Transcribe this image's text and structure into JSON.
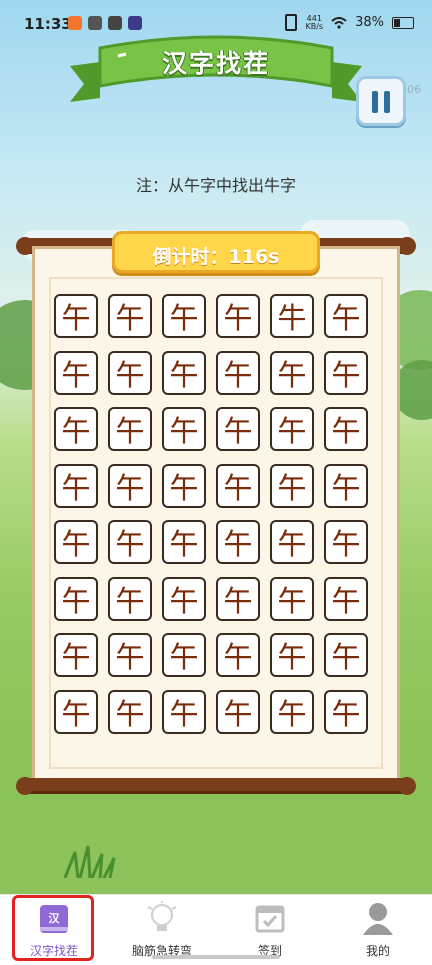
{
  "status_bar": {
    "time": "11:33",
    "net_speed_value": "441",
    "net_speed_unit": "KB/s",
    "battery": "38%"
  },
  "title": "汉字找茬",
  "watermark": "0x603e06",
  "note": "注：从午字中找出牛字",
  "timer": "倒计时：116s",
  "grid": {
    "rows": [
      [
        "午",
        "午",
        "午",
        "午",
        "牛",
        "午"
      ],
      [
        "午",
        "午",
        "午",
        "午",
        "午",
        "午"
      ],
      [
        "午",
        "午",
        "午",
        "午",
        "午",
        "午"
      ],
      [
        "午",
        "午",
        "午",
        "午",
        "午",
        "午"
      ],
      [
        "午",
        "午",
        "午",
        "午",
        "午",
        "午"
      ],
      [
        "午",
        "午",
        "午",
        "午",
        "午",
        "午"
      ],
      [
        "午",
        "午",
        "午",
        "午",
        "午",
        "午"
      ],
      [
        "午",
        "午",
        "午",
        "午",
        "午",
        "午"
      ]
    ]
  },
  "nav": [
    {
      "label": "汉字找茬",
      "icon": "book-icon",
      "active": true,
      "icon_text": "汉"
    },
    {
      "label": "脑筋急转弯",
      "icon": "lightbulb-icon",
      "active": false
    },
    {
      "label": "签到",
      "icon": "calendar-check-icon",
      "active": false
    },
    {
      "label": "我的",
      "icon": "user-icon",
      "active": false
    }
  ],
  "colors": {
    "accent_active": "#7a54c9",
    "tile_text": "#7a2c0a",
    "timer_bg": "#ffd54a",
    "ribbon_green": "#6fbf3d",
    "highlight_red": "#e0241d"
  }
}
